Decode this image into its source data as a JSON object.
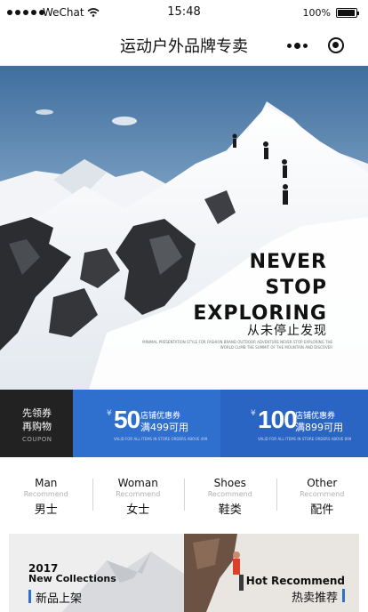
{
  "status_bar": {
    "carrier": "WeChat",
    "time": "15:48",
    "battery": "100%",
    "battery_level": 1.0
  },
  "nav": {
    "title": "运动户外品牌专卖",
    "more_icon": "more-dots-icon",
    "close_icon": "target-close-icon"
  },
  "hero": {
    "headline": [
      "NEVER",
      "STOP",
      "EXPLORING"
    ],
    "subtitle": "从未停止发现",
    "fine_print": "MINIMAL PRESENTATION STYLE FOR FASHION BRAND OUTDOOR ADVENTURE NEVER STOP EXPLORING THE WORLD CLIMB THE SUMMIT OF THE MOUNTAIN AND DISCOVER"
  },
  "coupons": {
    "head": {
      "line1": "先领券",
      "line2": "再购物",
      "label": "COUPON"
    },
    "items": [
      {
        "currency": "¥",
        "amount": "50",
        "name": "店铺优惠券",
        "condition": "满499可用",
        "fine": "VALID FOR ALL ITEMS IN STORE ORDERS ABOVE 499"
      },
      {
        "currency": "¥",
        "amount": "100",
        "name": "店铺优惠券",
        "condition": "满899可用",
        "fine": "VALID FOR ALL ITEMS IN STORE ORDERS ABOVE 899"
      }
    ]
  },
  "categories": [
    {
      "en": "Man",
      "sub": "Recommend",
      "cn": "男士"
    },
    {
      "en": "Woman",
      "sub": "Recommend",
      "cn": "女士"
    },
    {
      "en": "Shoes",
      "sub": "Recommend",
      "cn": "鞋类"
    },
    {
      "en": "Other",
      "sub": "Recommend",
      "cn": "配件"
    }
  ],
  "promos": {
    "new": {
      "year": "2017",
      "title": "New Collections",
      "cn": "新品上架"
    },
    "hot": {
      "title": "Hot Recommend",
      "cn": "热卖推荐"
    }
  },
  "colors": {
    "accent": "#2f6fce",
    "dark": "#222222"
  }
}
